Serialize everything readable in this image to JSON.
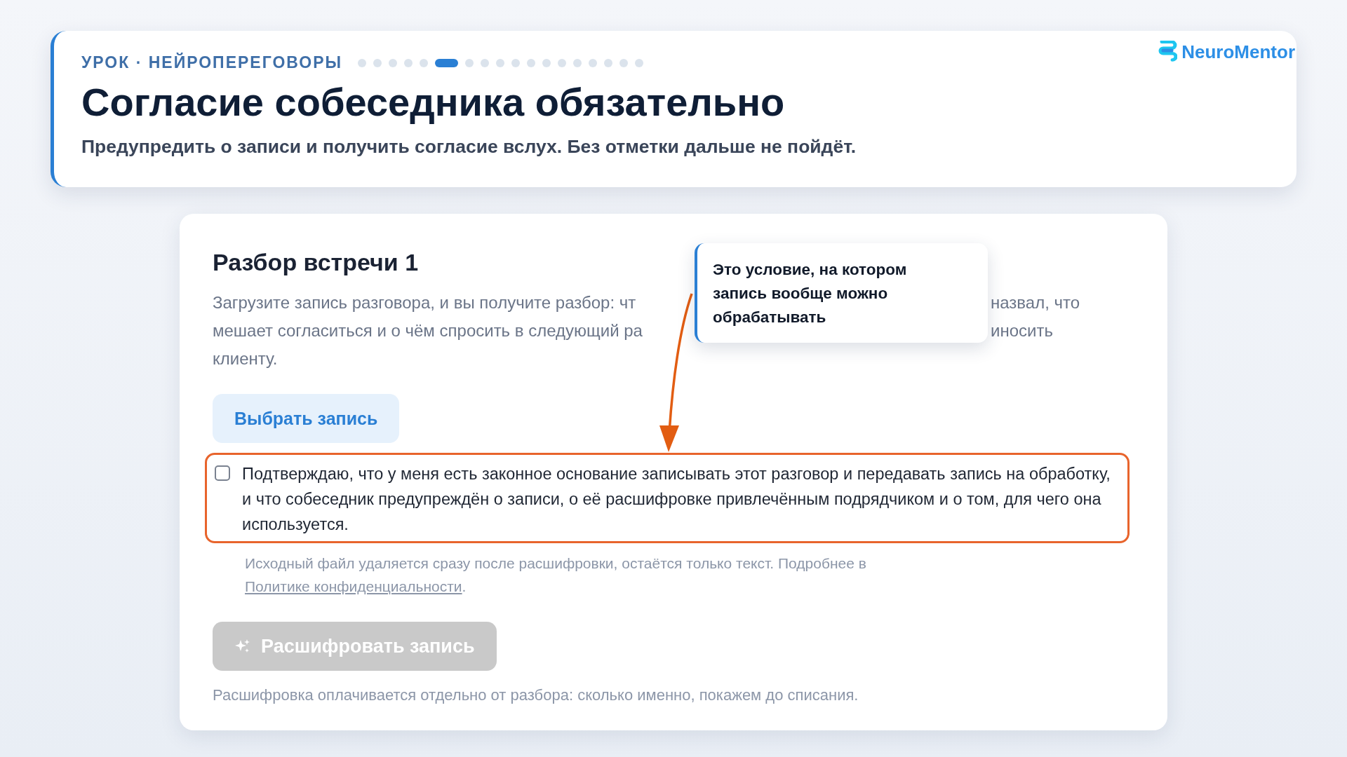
{
  "header": {
    "eyebrow": "УРОК · НЕЙРОПЕРЕГОВОРЫ",
    "progress_steps": [
      {
        "selected": false
      },
      {
        "selected": false
      },
      {
        "selected": false
      },
      {
        "selected": false
      },
      {
        "selected": false
      },
      {
        "selected": true
      },
      {
        "selected": false
      },
      {
        "selected": false
      },
      {
        "selected": false
      },
      {
        "selected": false
      },
      {
        "selected": false
      },
      {
        "selected": false
      },
      {
        "selected": false
      },
      {
        "selected": false
      },
      {
        "selected": false
      },
      {
        "selected": false
      },
      {
        "selected": false
      },
      {
        "selected": false
      }
    ],
    "title": "Согласие собеседника обязательно",
    "subtitle": "Предупредить о записи и получить согласие вслух. Без отметки дальше не пойдёт.",
    "logo": "NeuroMentor"
  },
  "card": {
    "title": "Разбор встречи 1",
    "description_lines": [
      {
        "left": "Загрузите запись разговора, и вы получите разбор: чт",
        "right": "назвал, что"
      },
      {
        "left": "мешает согласиться и о чём спросить в следующий ра",
        "right": "иносить"
      },
      {
        "left": "клиенту."
      }
    ],
    "choose_button": "Выбрать запись",
    "consent": {
      "checked": false,
      "highlighted": true,
      "label": "Подтверждаю, что у меня есть законное основание записывать этот разговор и передавать запись на обработку, и что собеседник предупреждён о записи, о её расшифровке привлечённым подрядчиком и о том, для чего она используется."
    },
    "note": {
      "text": "Исходный файл удаляется сразу после расшифровки, остаётся только текст. Подробнее в ",
      "link": "Политике конфиденциальности",
      "end": "."
    },
    "transcribe_button": {
      "label": "Расшифровать запись",
      "disabled": true
    },
    "footnote": "Расшифровка оплачивается отдельно от разбора: сколько именно, покажем до списания."
  },
  "callout": {
    "text": "Это условие, на котором запись вообще можно обрабатывать"
  }
}
